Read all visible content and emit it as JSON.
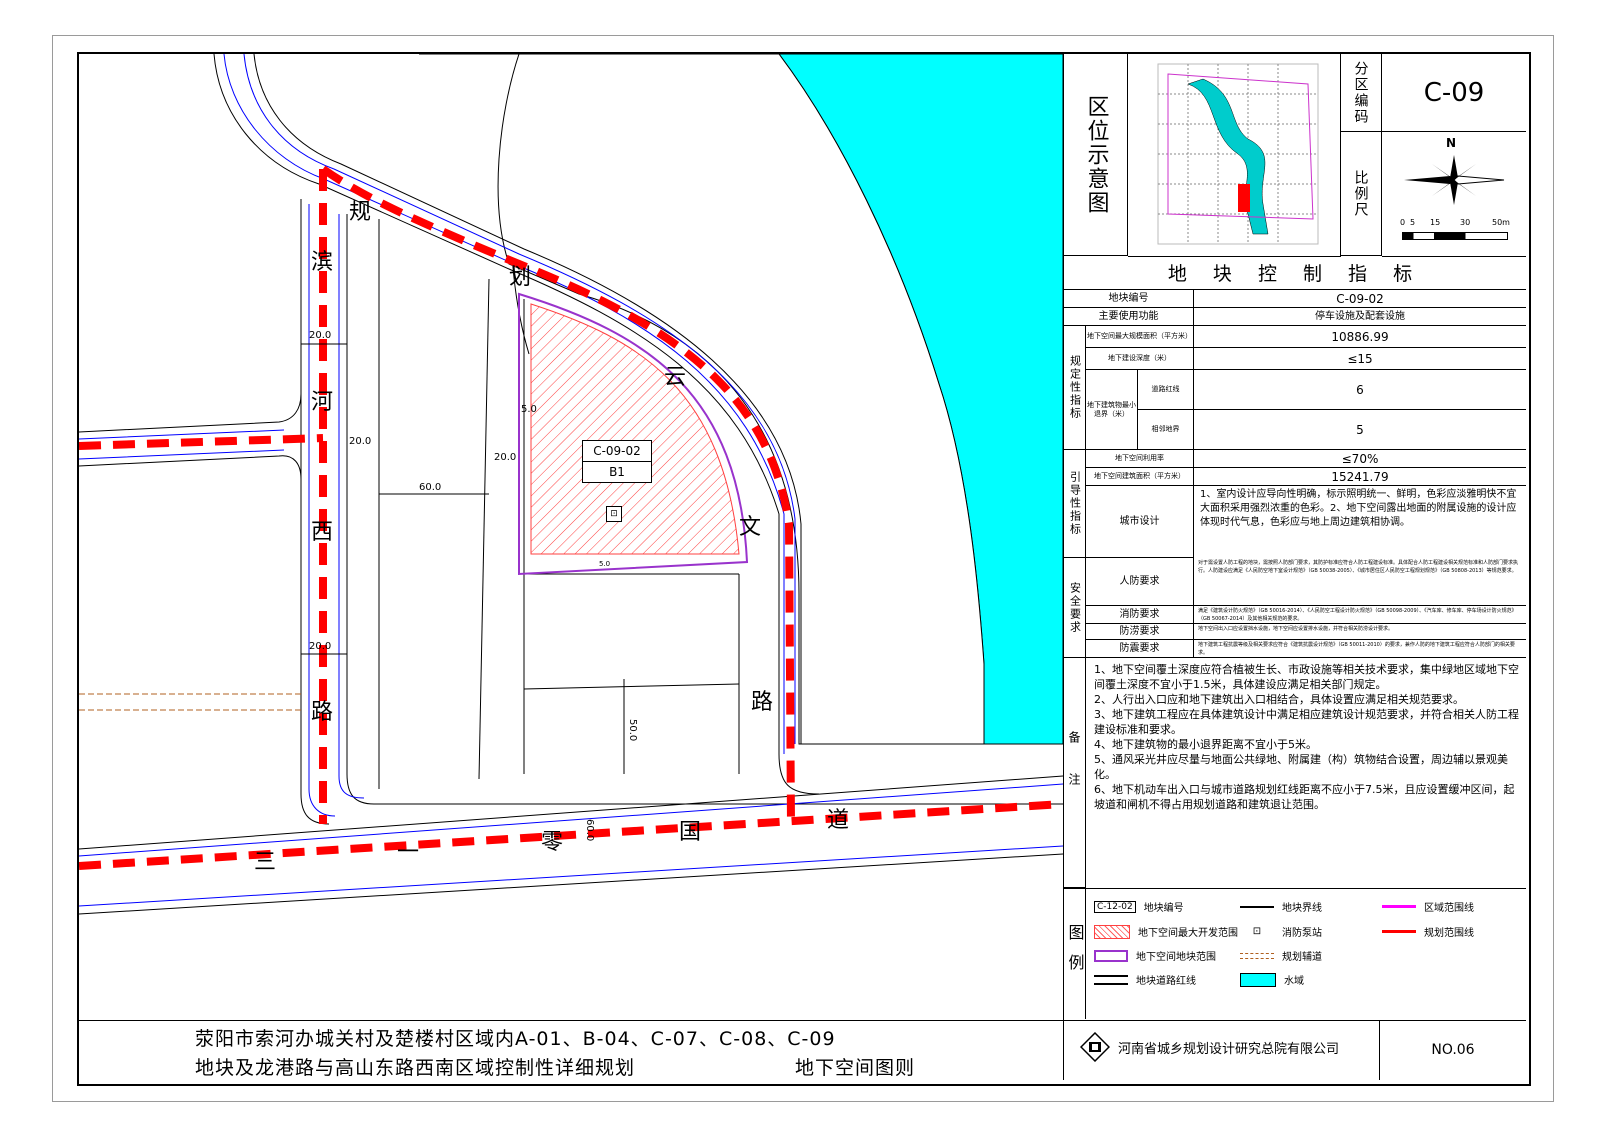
{
  "map": {
    "parcel_id": "C-09-02",
    "parcel_code": "B1",
    "parcel_icon": "fire-hydrant-icon",
    "road_chars": {
      "gui": "规",
      "hua": "划",
      "yun": "云",
      "wen": "文",
      "lu_e": "路",
      "bin": "滨",
      "he": "河",
      "xi": "西",
      "lu_w": "路",
      "san": "三",
      "yi": "一",
      "ling": "零",
      "guo": "国",
      "dao": "道"
    },
    "dims": {
      "d20_top_left": "20.0",
      "d20_mid_left": "20.0",
      "d20_b": "20.0",
      "d60_a": "60.0",
      "d20_low_left": "20.0",
      "d5": "5.0",
      "d50": "50.0",
      "d60_b": "60.0",
      "d5_small": "5.0"
    },
    "colors": {
      "water": "#00ffff",
      "red": "#ff0000",
      "road_blue": "#0000ff",
      "boundary": "#9933cc"
    }
  },
  "panel": {
    "location_label": "区位示意图",
    "zone_code_label": "分区编码",
    "zone_code": "C-09",
    "scale_label": "比例尺",
    "north": "N",
    "scale_ticks": [
      "0",
      "5",
      "15",
      "30",
      "50m"
    ],
    "table_title": "地 块 控 制 指 标",
    "rows": {
      "parcel_no_label": "地块编号",
      "parcel_no": "C-09-02",
      "use_label": "主要使用功能",
      "use": "停车设施及配套设施",
      "group_regulatory": "规定性指标",
      "area_label": "地下空间最大规模面积（平方米）",
      "area": "10886.99",
      "depth_label": "地下建设深度（米）",
      "depth": "≤15",
      "setback_label": "地下建筑物最小退界（米）",
      "road_line_label": "道路红线",
      "road_line": "6",
      "adjacent_label": "相邻地界",
      "adjacent": "5",
      "group_guide": "引导性指标",
      "ratio_label": "地下空间利用率",
      "ratio": "≤70%",
      "gfa_label": "地下空间建筑面积（平方米）",
      "gfa": "15241.79",
      "urban_label": "城市设计",
      "urban_text": "1、室内设计应导向性明确，标示照明统一、鲜明，色彩应淡雅明快不宜大面积采用强烈浓重的色彩。2、地下空间露出地面的附属设施的设计应体现时代气息，色彩应与地上周边建筑相协调。",
      "group_safety": "安全要求",
      "civil_label": "人防要求",
      "civil_text": "对于需设置人防工程的地块，需按照人防部门要求，其防护标准应符合人防工程建设标准。具体配合人防工程建设相关规范标准和人防部门要求执行。人防建设应满足《人民防空地下室设计规范》（GB 50038-2005）、《城市居住区人民防空工程规划规范》（GB 50808-2013）等规范要求。",
      "fire_label": "消防要求",
      "fire_text": "满足《建筑设计防火规范》（GB 50016-2014）、《人民防空工程设计防火规范》（GB 50098-2009）、《汽车库、修车库、停车场设计防火规范》（GB 50067-2014）及其他相关规范的要求。",
      "flood_label": "防涝要求",
      "flood_text": "地下空间出入口应设置挡水设施，地下空间应设置排水设施，并符合相关防涝设计要求。",
      "quake_label": "防震要求",
      "quake_text": "地下建筑工程抗震等级及相关要求应符合《建筑抗震设计规范》（GB 50011-2010）的要求，兼作人防的地下建筑工程应符合人防部门的相关要求。",
      "notes_label": "备注",
      "notes": [
        "1、地下空间覆土深度应符合植被生长、市政设施等相关技术要求，集中绿地区域地下空间覆土深度不宜小于1.5米，具体建设应满足相关部门规定。",
        "2、人行出入口应和地下建筑出入口相结合，具体设置应满足相关规范要求。",
        "3、地下建筑工程应在具体建筑设计中满足相应建筑设计规范要求，并符合相关人防工程建设标准和要求。",
        "4、地下建筑物的最小退界距离不宜小于5米。",
        "5、通风采光井应尽量与地面公共绿地、附属建（构）筑物结合设置，周边辅以景观美化。",
        "6、地下机动车出入口与城市道路规划红线距离不应小于7.5米，且应设置缓冲区间，起坡道和闸机不得占用规划道路和建筑退让范围。"
      ]
    },
    "legend_label": "图例",
    "legend": {
      "parcel_no": "地块编号",
      "parcel_no_sample": "C-12-02",
      "max_dev": "地下空间最大开发范围",
      "underground_parcel": "地下空间地块范围",
      "road_red": "地块道路红线",
      "parcel_line": "地块界线",
      "fire_station": "消防泵站",
      "planned_road": "规划辅道",
      "water": "水域",
      "zone_line": "区域范围线",
      "plan_line": "规划范围线"
    }
  },
  "footer": {
    "title_line1": "荥阳市索河办城关村及楚楼村区域内A-01、B-04、C-07、C-08、C-09",
    "title_line2": "地块及龙港路与高山东路西南区域控制性详细规划",
    "title_line2b": "地下空间图则",
    "institute": "河南省城乡规划设计研究总院有限公司",
    "sheet_no": "NO.06"
  }
}
